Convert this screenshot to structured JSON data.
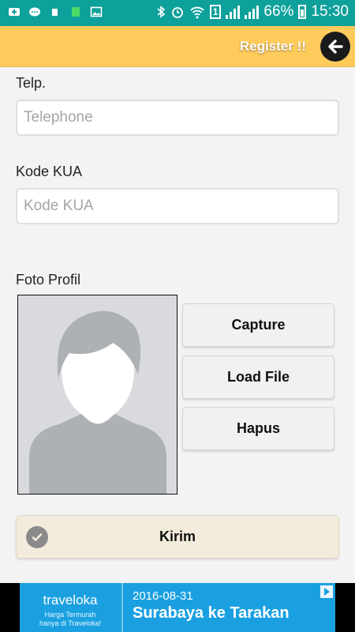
{
  "status_bar": {
    "battery": "66%",
    "time": "15:30",
    "sim": "1"
  },
  "header": {
    "title": "Register !!",
    "back_icon": "arrow-left-icon"
  },
  "form": {
    "telp": {
      "label": "Telp.",
      "placeholder": "Telephone",
      "value": ""
    },
    "kode_kua": {
      "label": "Kode KUA",
      "placeholder": "Kode KUA",
      "value": ""
    },
    "foto": {
      "label": "Foto Profil"
    }
  },
  "photo_buttons": {
    "capture": "Capture",
    "load_file": "Load File",
    "hapus": "Hapus"
  },
  "submit": {
    "label": "Kirim",
    "icon": "check-circle-icon"
  },
  "ad": {
    "brand": "traveloka",
    "tagline_1": "Harga Termurah",
    "tagline_2": "hanya di Traveloka!",
    "date": "2016-08-31",
    "route": "Surabaya ke Tarakan"
  },
  "colors": {
    "status_bar": "#0ea09a",
    "header": "#ffcc5c",
    "submit_bg": "#f3ecdc",
    "ad_bg": "#1aa0e0"
  }
}
